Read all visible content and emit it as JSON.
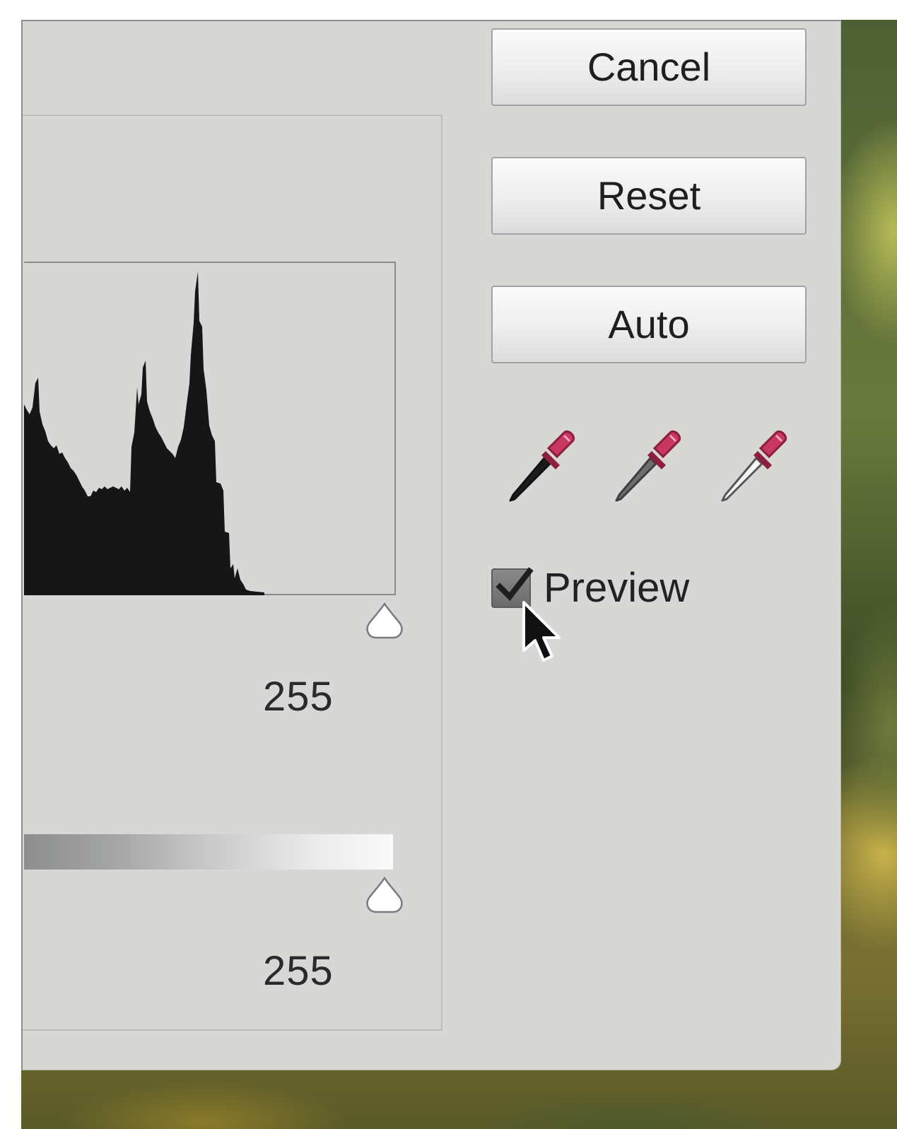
{
  "buttons": {
    "cancel": "Cancel",
    "reset": "Reset",
    "auto": "Auto"
  },
  "eyedroppers": [
    {
      "icon": "black-point-eyedropper-icon"
    },
    {
      "icon": "gray-point-eyedropper-icon"
    },
    {
      "icon": "white-point-eyedropper-icon"
    }
  ],
  "preview": {
    "label": "Preview",
    "checked": true
  },
  "input_levels": {
    "white_value": "255"
  },
  "output_levels": {
    "white_value": "255"
  },
  "colors": {
    "dialog_background": "#d7d7d5",
    "histogram_fill": "#161616",
    "eyedropper_bulb": "#c8375f"
  }
}
